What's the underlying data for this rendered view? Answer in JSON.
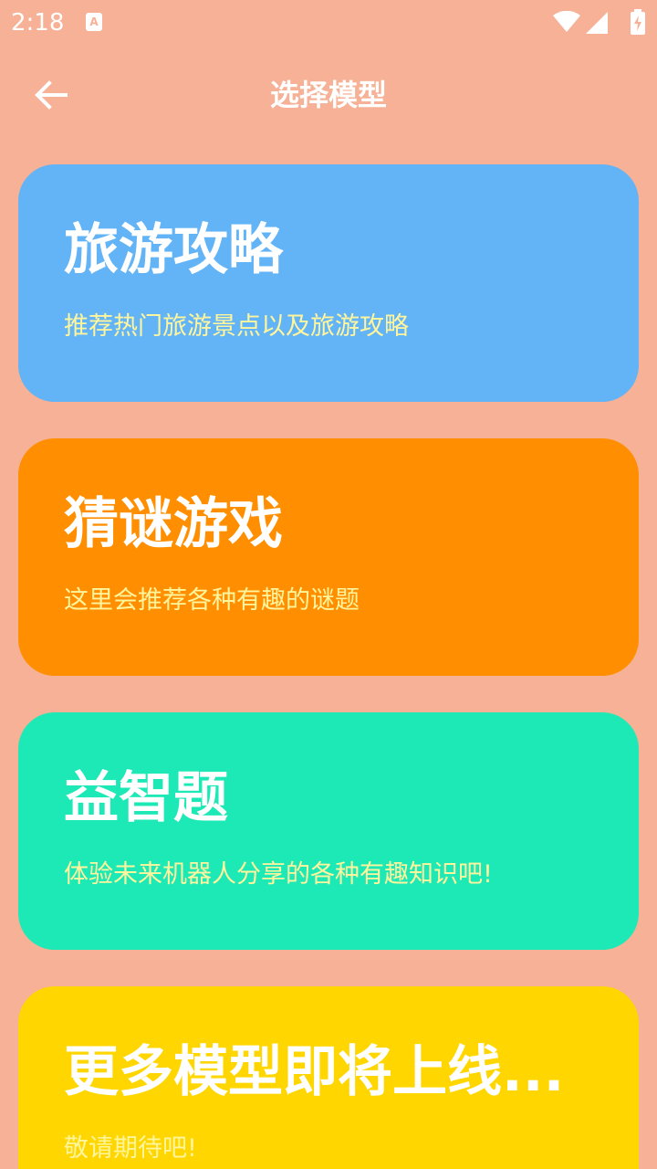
{
  "colors": {
    "background": "#F6B196",
    "status_text": "#FFFFFF",
    "title_text": "#FFFFFF",
    "subtitle_text": "#FFF59D"
  },
  "status_bar": {
    "time": "2:18",
    "icons": [
      "app-notification-icon",
      "wifi-icon",
      "cell-signal-icon",
      "battery-charging-icon"
    ]
  },
  "app_bar": {
    "back_icon": "arrow-left-icon",
    "title": "选择模型"
  },
  "cards": [
    {
      "title": "旅游攻略",
      "subtitle": "推荐热门旅游景点以及旅游攻略",
      "color": "#63B4F6"
    },
    {
      "title": "猜谜游戏",
      "subtitle": "这里会推荐各种有趣的谜题",
      "color": "#FF8F00"
    },
    {
      "title": "益智题",
      "subtitle": "体验未来机器人分享的各种有趣知识吧!",
      "color": "#1DE9B6"
    },
    {
      "title": "更多模型即将上线...",
      "subtitle": "敬请期待吧!",
      "color": "#FFD600"
    }
  ]
}
